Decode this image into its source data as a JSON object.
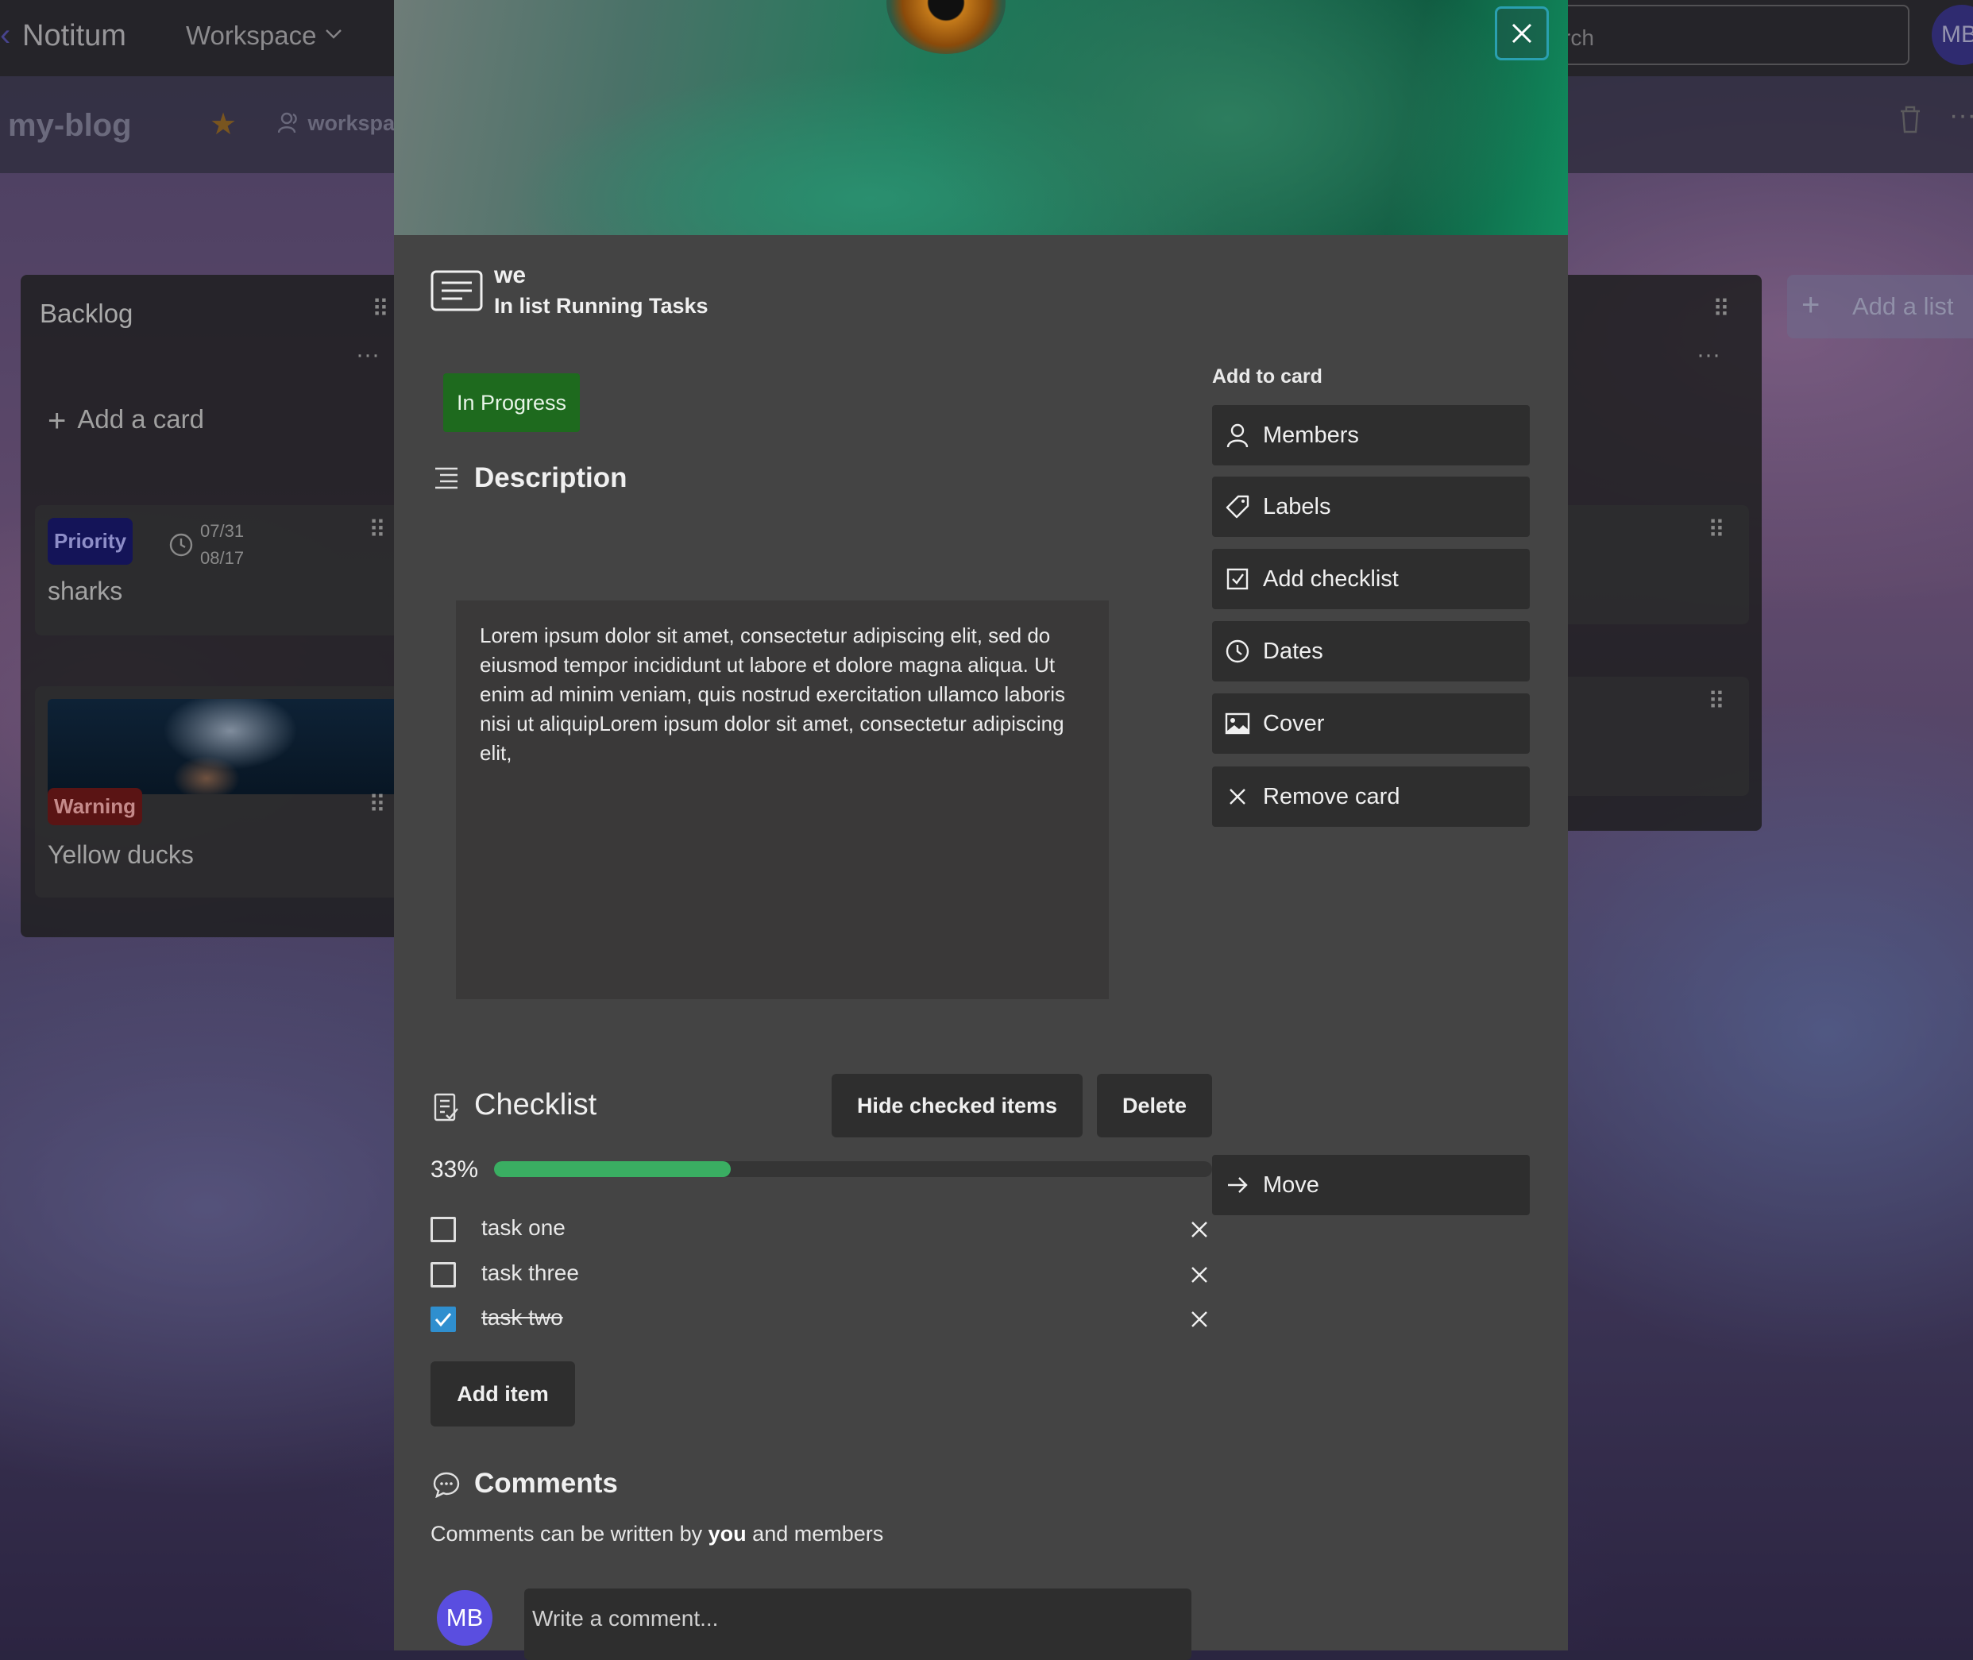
{
  "topbar": {
    "brand": "Notitum",
    "workspace_label": "Workspace",
    "search_placeholder": "rch",
    "avatar_initials": "MB"
  },
  "board": {
    "title": "my-blog",
    "workspace_tag": "workspa"
  },
  "lists": {
    "backlog": {
      "title": "Backlog",
      "add_card": "Add a card",
      "cards": [
        {
          "label": "Priority",
          "start_date": "07/31",
          "due_date": "08/17",
          "title": "sharks"
        },
        {
          "label": "Warning",
          "title": "Yellow ducks"
        }
      ]
    },
    "add_list": "Add a list"
  },
  "modal": {
    "card_name": "we",
    "list_line": "In list Running Tasks",
    "status_label": "In Progress",
    "description": {
      "heading": "Description",
      "text": "Lorem ipsum dolor sit amet, consectetur adipiscing elit, sed do eiusmod tempor incididunt ut labore et dolore magna aliqua. Ut enim ad minim veniam, quis nostrud exercitation ullamco laboris nisi ut aliquipLorem ipsum dolor sit amet, consectetur adipiscing elit,"
    },
    "add_to_card": {
      "heading": "Add to card",
      "buttons": [
        {
          "label": "Members",
          "icon": "person-icon"
        },
        {
          "label": "Labels",
          "icon": "tag-icon"
        },
        {
          "label": "Add checklist",
          "icon": "checkbox-icon"
        },
        {
          "label": "Dates",
          "icon": "clock-icon"
        },
        {
          "label": "Cover",
          "icon": "image-icon"
        },
        {
          "label": "Remove card",
          "icon": "close-icon"
        }
      ],
      "move": {
        "label": "Move",
        "icon": "arrow-right-icon"
      }
    },
    "checklist": {
      "heading": "Checklist",
      "hide_checked": "Hide checked items",
      "delete": "Delete",
      "progress_text": "33%",
      "progress_fraction": 0.33,
      "progress_color": "#3aae62",
      "items": [
        {
          "text": "task one",
          "checked": false
        },
        {
          "text": "task three",
          "checked": false
        },
        {
          "text": "task two",
          "checked": true
        }
      ],
      "add_item": "Add item"
    },
    "comments": {
      "heading": "Comments",
      "note_prefix": "Comments can be written by ",
      "note_bold": "you",
      "note_suffix": " and members",
      "avatar_initials": "MB",
      "placeholder": "Write a comment..."
    }
  }
}
